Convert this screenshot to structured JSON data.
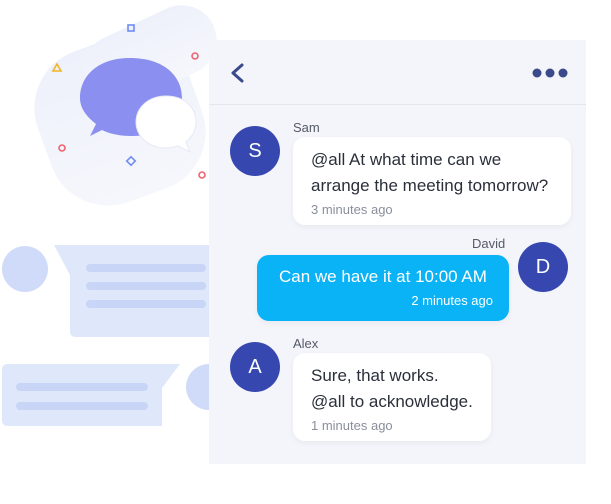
{
  "header": {
    "back_icon": "chevron-left-icon",
    "more_icon": "more-horizontal-icon"
  },
  "messages": [
    {
      "sender": "Sam",
      "avatar_letter": "S",
      "lines": [
        "@all At what time can we",
        "arrange the meeting tomorrow?"
      ],
      "time": "3 minutes ago",
      "outgoing": false
    },
    {
      "sender": "David",
      "avatar_letter": "D",
      "lines": [
        "Can we have it at 10:00 AM"
      ],
      "time": "2 minutes ago",
      "outgoing": true
    },
    {
      "sender": "Alex",
      "avatar_letter": "A",
      "lines": [
        "Sure, that works.",
        "@all to acknowledge."
      ],
      "time": "1 minutes ago",
      "outgoing": false
    }
  ],
  "colors": {
    "avatar": "#3647b0",
    "outgoing_bubble": "#0ab3f5",
    "incoming_bubble": "#ffffff",
    "panel_background": "#f4f5fa",
    "icon": "#3a4a8a"
  }
}
